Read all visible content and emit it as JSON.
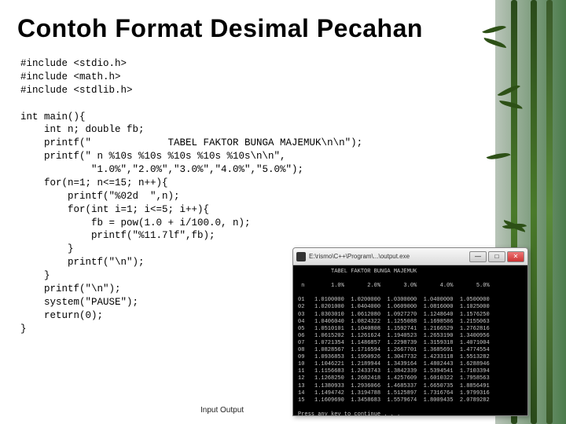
{
  "title": "Contoh Format Desimal Pecahan",
  "code": "#include <stdio.h>\n#include <math.h>\n#include <stdlib.h>\n\nint main(){\n    int n; double fb;\n    printf(\"             TABEL FAKTOR BUNGA MAJEMUK\\n\\n\");\n    printf(\" n %10s %10s %10s %10s %10s\\n\\n\",\n            \"1.0%\",\"2.0%\",\"3.0%\",\"4.0%\",\"5.0%\");\n    for(n=1; n<=15; n++){\n        printf(\"%02d  \",n);\n        for(int i=1; i<=5; i++){\n            fb = pow(1.0 + i/100.0, n);\n            printf(\"%11.7lf\",fb);\n        }\n        printf(\"\\n\");\n    }\n    printf(\"\\n\");\n    system(\"PAUSE\");\n    return(0);\n}",
  "footer": "Input Output",
  "console": {
    "titlebar": "E:\\rismo\\C++\\Program\\...\\output.exe",
    "btn_min": "—",
    "btn_max": "□",
    "btn_close": "✕",
    "heading": "          TABEL FAKTOR BUNGA MAJEMUK",
    "col_header": " n        1.0%       2.0%       3.0%       4.0%       5.0%",
    "prompt": "Press any key to continue . . ."
  },
  "chart_data": {
    "type": "table",
    "title": "TABEL FAKTOR BUNGA MAJEMUK",
    "columns": [
      "n",
      "1.0%",
      "2.0%",
      "3.0%",
      "4.0%",
      "5.0%"
    ],
    "rows": [
      [
        "01",
        "1.0100000",
        "1.0200000",
        "1.0300000",
        "1.0400000",
        "1.0500000"
      ],
      [
        "02",
        "1.0201000",
        "1.0404000",
        "1.0609000",
        "1.0816000",
        "1.1025000"
      ],
      [
        "03",
        "1.0303010",
        "1.0612080",
        "1.0927270",
        "1.1248640",
        "1.1576250"
      ],
      [
        "04",
        "1.0406040",
        "1.0824322",
        "1.1255088",
        "1.1698586",
        "1.2155063"
      ],
      [
        "05",
        "1.0510101",
        "1.1040808",
        "1.1592741",
        "1.2166529",
        "1.2762816"
      ],
      [
        "06",
        "1.0615202",
        "1.1261624",
        "1.1940523",
        "1.2653190",
        "1.3400956"
      ],
      [
        "07",
        "1.0721354",
        "1.1486857",
        "1.2298739",
        "1.3159318",
        "1.4071004"
      ],
      [
        "08",
        "1.0828567",
        "1.1716594",
        "1.2667701",
        "1.3685691",
        "1.4774554"
      ],
      [
        "09",
        "1.0936853",
        "1.1950926",
        "1.3047732",
        "1.4233118",
        "1.5513282"
      ],
      [
        "10",
        "1.1046221",
        "1.2189944",
        "1.3439164",
        "1.4802443",
        "1.6288946"
      ],
      [
        "11",
        "1.1156683",
        "1.2433743",
        "1.3842339",
        "1.5394541",
        "1.7103394"
      ],
      [
        "12",
        "1.1268250",
        "1.2682418",
        "1.4257609",
        "1.6010322",
        "1.7958563"
      ],
      [
        "13",
        "1.1380933",
        "1.2936066",
        "1.4685337",
        "1.6650735",
        "1.8856491"
      ],
      [
        "14",
        "1.1494742",
        "1.3194788",
        "1.5125897",
        "1.7316764",
        "1.9799316"
      ],
      [
        "15",
        "1.1609690",
        "1.3458683",
        "1.5579674",
        "1.8009435",
        "2.0789282"
      ]
    ]
  }
}
